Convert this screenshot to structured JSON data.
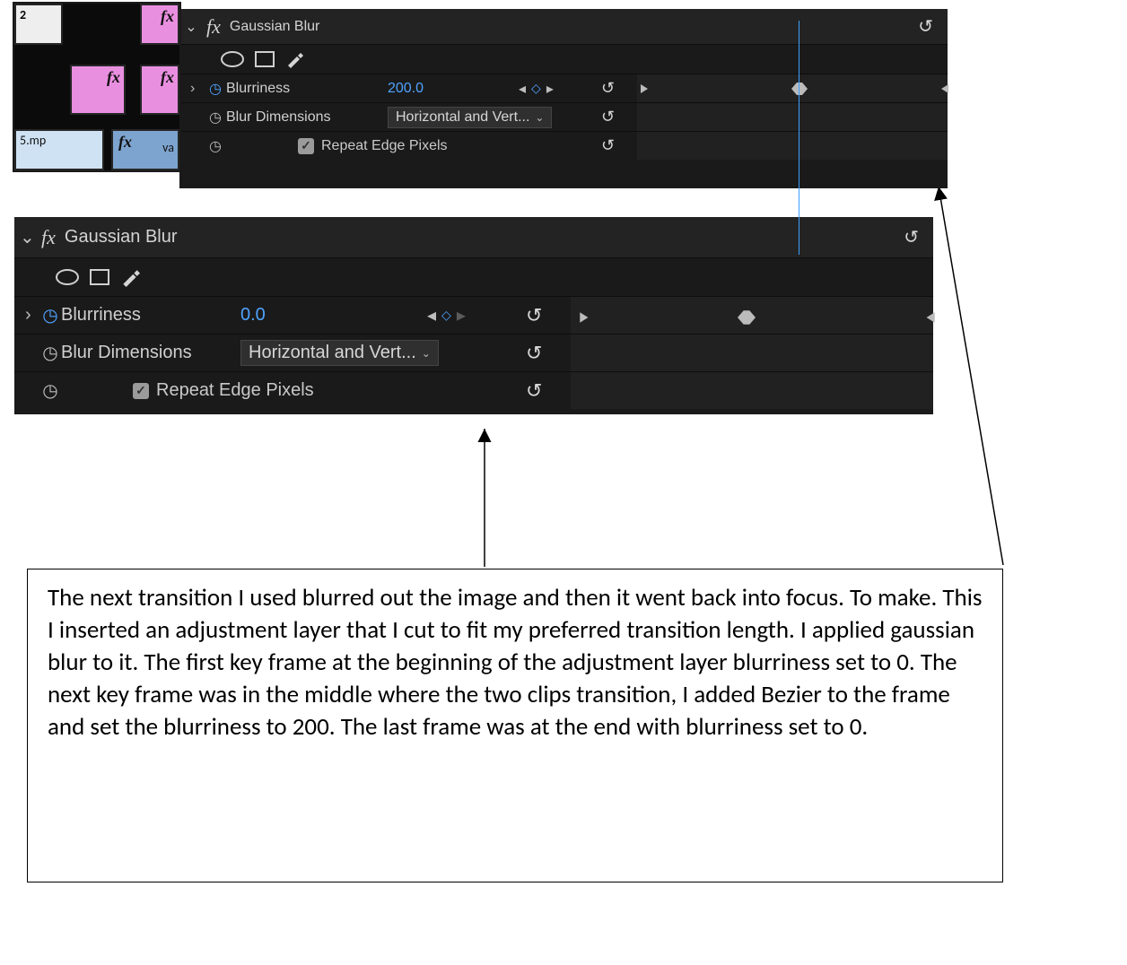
{
  "timeline": {
    "track_label": "2",
    "filename_fragment": "5.mp",
    "text_fragment": "va",
    "fx_glyph": "fx"
  },
  "panel1": {
    "effect_name": "Gaussian Blur",
    "blurriness_label": "Blurriness",
    "blurriness_value": "200.0",
    "blur_dim_label": "Blur Dimensions",
    "blur_dim_value": "Horizontal and Vert...",
    "repeat_edge_label": "Repeat Edge Pixels",
    "playhead_pct": 52,
    "keyframes": {
      "start_arrow_pct": 3,
      "bezier_pct": 52,
      "end_arrow_pct": 99
    }
  },
  "panel2": {
    "effect_name": "Gaussian Blur",
    "blurriness_label": "Blurriness",
    "blurriness_value": "0.0",
    "blur_dim_label": "Blur Dimensions",
    "blur_dim_value": "Horizontal and Vert...",
    "repeat_edge_label": "Repeat Edge Pixels",
    "keyframes": {
      "start_arrow_pct": 4,
      "bezier_pct": 48,
      "end_arrow_pct": 99
    }
  },
  "annotation": {
    "text": "The next transition I used blurred out the image and then it went back into focus. To make. This I inserted an adjustment layer that I cut to fit my preferred transition length. I applied gaussian blur to it. The first key frame at the beginning of the adjustment layer blurriness set to 0. The next key frame was in the middle where the two clips transition, I added Bezier to the frame and set the blurriness to 200. The last frame was at the end with blurriness set to 0."
  }
}
